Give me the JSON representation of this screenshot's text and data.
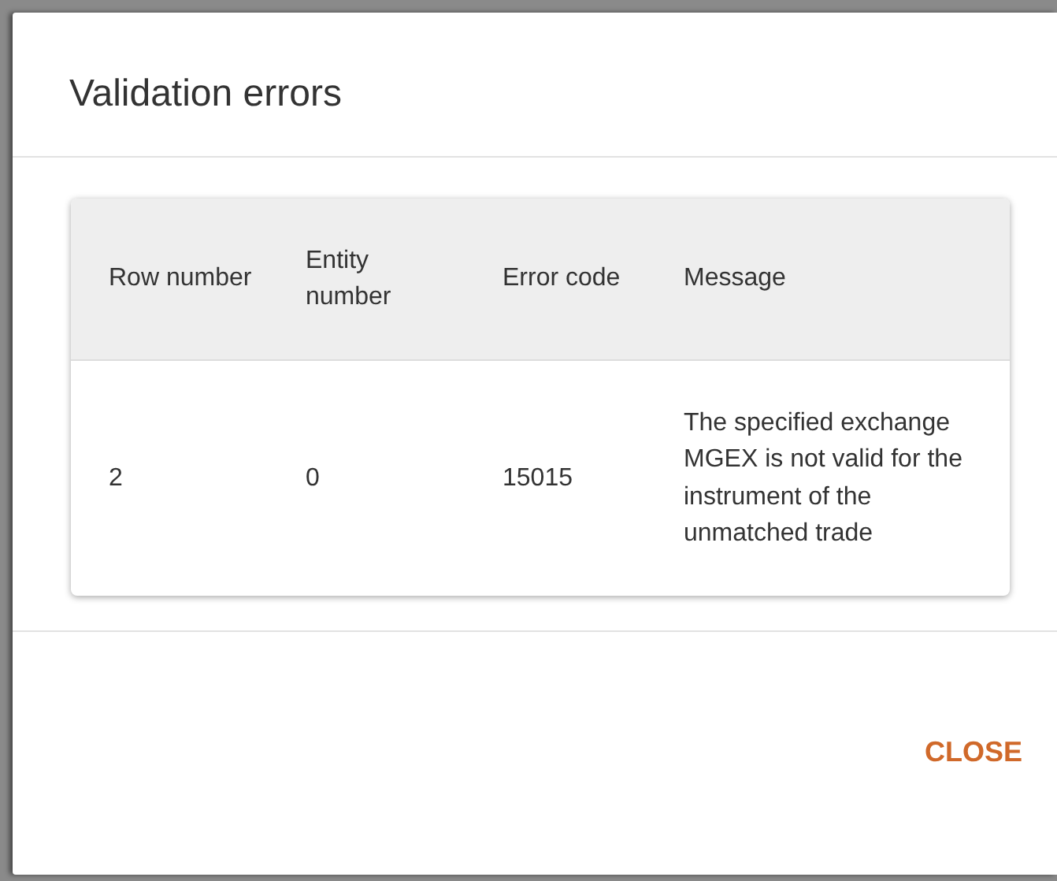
{
  "dialog": {
    "title": "Validation errors",
    "table": {
      "columns": [
        "Row number",
        "Entity number",
        "Error code",
        "Message"
      ],
      "rows": [
        [
          "2",
          "0",
          "15015",
          "The specified exchange MGEX is not valid for the instrument of the unmatched trade"
        ]
      ]
    },
    "buttons": [
      "CLOSE"
    ]
  }
}
